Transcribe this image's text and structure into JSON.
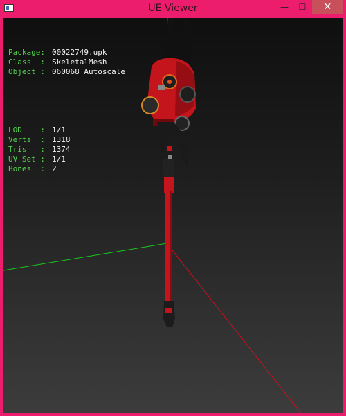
{
  "window": {
    "title": "UE Viewer"
  },
  "titlebar_buttons": {
    "minimize": "—",
    "maximize": "☐",
    "close": "✕"
  },
  "info_block_1": [
    {
      "key": "Package:",
      "value": "00022749.upk"
    },
    {
      "key": "Class  :",
      "value": "SkeletalMesh"
    },
    {
      "key": "Object :",
      "value": "060068_Autoscale"
    }
  ],
  "info_block_2": [
    {
      "key": "LOD    :",
      "value": "1/1"
    },
    {
      "key": "Verts  :",
      "value": "1318"
    },
    {
      "key": "Tris   :",
      "value": "1374"
    },
    {
      "key": "UV Set :",
      "value": "1/1"
    },
    {
      "key": "Bones  :",
      "value": "2"
    }
  ],
  "colors": {
    "frame": "#ec1d6c",
    "label": "#53d34c",
    "value": "#f2f2f2",
    "x_axis": "#d0101c",
    "y_axis": "#19c81e",
    "z_axis": "#1a2bd6",
    "mesh": "#c4141c"
  }
}
